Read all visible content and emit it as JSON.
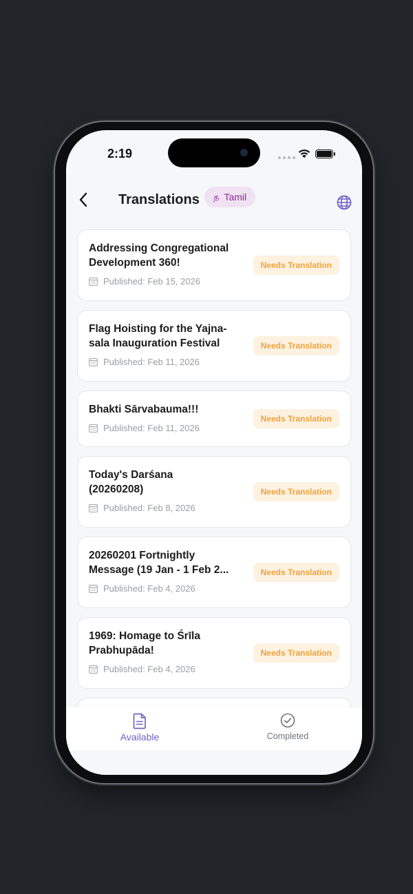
{
  "status": {
    "time": "2:19"
  },
  "header": {
    "title": "Translations",
    "language_glyph": "த",
    "language": "Tamil"
  },
  "items": [
    {
      "title": "Addressing Congregational Development 360!",
      "published": "Published: Feb 15, 2026",
      "status": "Needs Translation"
    },
    {
      "title": "Flag Hoisting for the Yajna-sala Inauguration Festival",
      "published": "Published: Feb 11, 2026",
      "status": "Needs Translation"
    },
    {
      "title": "Bhakti Sārvabauma!!!",
      "published": "Published: Feb 11, 2026",
      "status": "Needs Translation"
    },
    {
      "title": "Today's Darśana (20260208)",
      "published": "Published: Feb 8, 2026",
      "status": "Needs Translation"
    },
    {
      "title": "20260201 Fortnightly Message (19 Jan - 1 Feb 2...",
      "published": "Published: Feb 4, 2026",
      "status": "Needs Translation"
    },
    {
      "title": "1969: Homage to Śrīla Prabhupāda!",
      "published": "Published: Feb 4, 2026",
      "status": "Needs Translation"
    }
  ],
  "tabs": {
    "available": "Available",
    "completed": "Completed"
  },
  "colors": {
    "accent": "#6e64c8",
    "badge_bg": "#fdf1e0",
    "badge_text": "#efa33c",
    "chip_bg": "#f1e2f3",
    "chip_text": "#8a2a92"
  }
}
